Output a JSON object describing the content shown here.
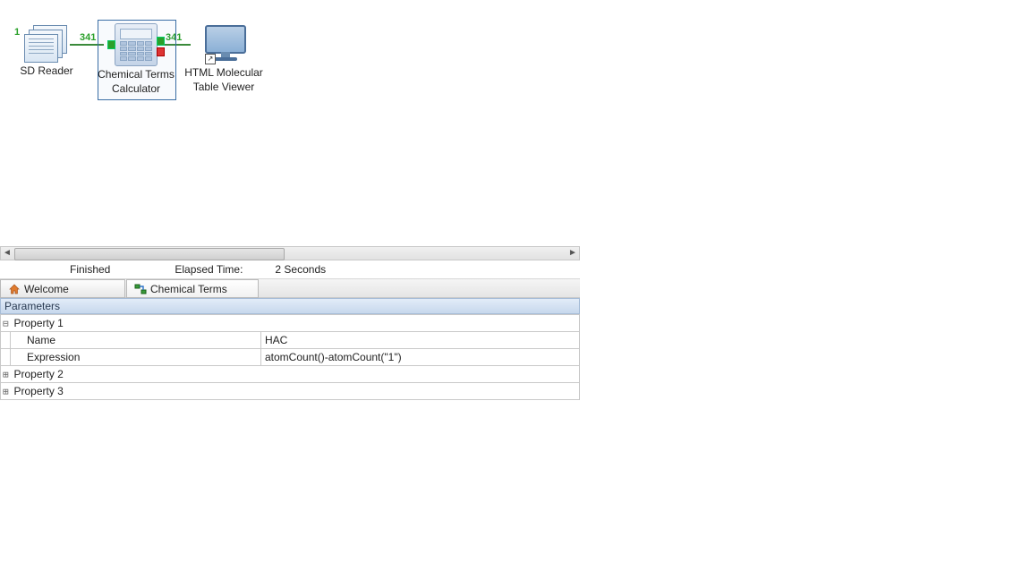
{
  "workflow": {
    "annotation_number": "1",
    "nodes": [
      {
        "id": "sd-reader",
        "label_l1": "SD Reader",
        "label_l2": ""
      },
      {
        "id": "chem-terms",
        "label_l1": "Chemical Terms",
        "label_l2": "Calculator"
      },
      {
        "id": "html-viewer",
        "label_l1": "HTML Molecular",
        "label_l2": "Table Viewer"
      }
    ],
    "edges": [
      {
        "count": "341"
      },
      {
        "count": "341"
      }
    ]
  },
  "status": {
    "state": "Finished",
    "elapsed_label": "Elapsed Time:",
    "elapsed_value": "2 Seconds"
  },
  "tabs": [
    {
      "id": "welcome",
      "label": "Welcome"
    },
    {
      "id": "chemterms",
      "label": "Chemical Terms"
    }
  ],
  "parameters": {
    "header": "Parameters",
    "rows": [
      {
        "tree": "⊟",
        "label": "Property 1",
        "value": ""
      },
      {
        "tree": "",
        "label": "Name",
        "value": "HAC",
        "sub": true
      },
      {
        "tree": "",
        "label": "Expression",
        "value": "atomCount()-atomCount(\"1\")",
        "sub": true
      },
      {
        "tree": "⊞",
        "label": "Property 2",
        "value": ""
      },
      {
        "tree": "⊞",
        "label": "Property 3",
        "value": ""
      }
    ]
  }
}
